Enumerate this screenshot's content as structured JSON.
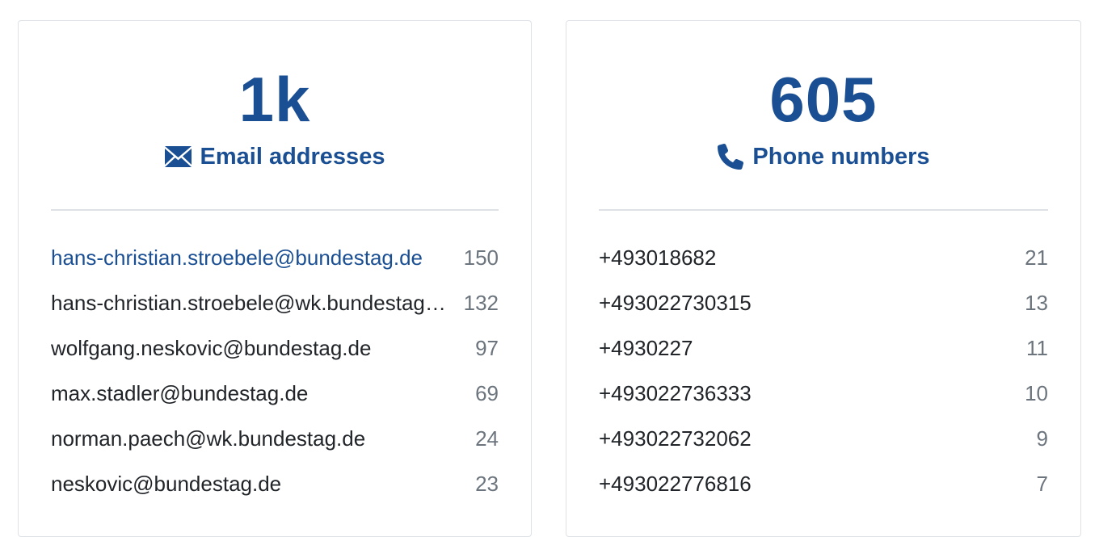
{
  "cards": {
    "email": {
      "value": "1k",
      "label": "Email addresses",
      "icon": "envelope-icon",
      "items": [
        {
          "name": "hans-christian.stroebele@bundestag.de",
          "count": "150"
        },
        {
          "name": "hans-christian.stroebele@wk.bundestag.de",
          "count": "132"
        },
        {
          "name": "wolfgang.neskovic@bundestag.de",
          "count": "97"
        },
        {
          "name": "max.stadler@bundestag.de",
          "count": "69"
        },
        {
          "name": "norman.paech@wk.bundestag.de",
          "count": "24"
        },
        {
          "name": "neskovic@bundestag.de",
          "count": "23"
        }
      ]
    },
    "phone": {
      "value": "605",
      "label": "Phone numbers",
      "icon": "phone-icon",
      "items": [
        {
          "name": "+493018682",
          "count": "21"
        },
        {
          "name": "+493022730315",
          "count": "13"
        },
        {
          "name": "+4930227",
          "count": "11"
        },
        {
          "name": "+493022736333",
          "count": "10"
        },
        {
          "name": "+493022732062",
          "count": "9"
        },
        {
          "name": "+493022776816",
          "count": "7"
        }
      ]
    }
  },
  "colors": {
    "accent": "#1b4f93",
    "text": "#212529",
    "muted": "#6c757d",
    "border": "#dee2e6"
  }
}
